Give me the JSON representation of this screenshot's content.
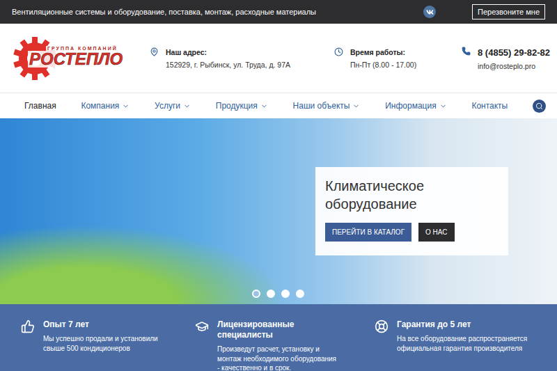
{
  "top_bar": {
    "tagline": "Вентиляционные системы и оборудование, поставка, монтаж, расходные материалы",
    "callback_button": "Перезвоните мне"
  },
  "logo": {
    "caption": "ГРУППА КОМПАНИЙ",
    "name": "РОСТЕПЛО"
  },
  "contacts": [
    {
      "label": "Наш адрес:",
      "value": "152929, г. Рыбинск, ул. Труда, д. 97А"
    },
    {
      "label": "Время работы:",
      "value": "Пн-Пт (8.00 - 17.00)"
    }
  ],
  "phone": {
    "number": "8 (4855) 29-82-82",
    "email": "info@rosteplo.pro"
  },
  "nav": [
    {
      "label": "Главная",
      "selected": true,
      "has_menu": false
    },
    {
      "label": "Компания",
      "selected": false,
      "has_menu": true
    },
    {
      "label": "Услуги",
      "selected": false,
      "has_menu": true
    },
    {
      "label": "Продукция",
      "selected": false,
      "has_menu": true
    },
    {
      "label": "Наши объекты",
      "selected": false,
      "has_menu": true
    },
    {
      "label": "Информация",
      "selected": false,
      "has_menu": true
    },
    {
      "label": "Контакты",
      "selected": false,
      "has_menu": false
    }
  ],
  "hero": {
    "title": "Климатическое оборудование",
    "buttons": [
      {
        "label": "ПЕРЕЙТИ В КАТАЛОГ",
        "kind": "primary"
      },
      {
        "label": "О НАС",
        "kind": "dark"
      }
    ],
    "slides": [
      {
        "selected": true
      },
      {
        "selected": false
      },
      {
        "selected": false
      },
      {
        "selected": false
      }
    ]
  },
  "features": [
    {
      "title": "Опыт 7 лет",
      "text": "Мы успешно продали и установили свыше 500 кондиционеров"
    },
    {
      "title": "Лицензированные специалисты",
      "text": "Произведут расчет, установку и монтаж необходимого оборудования - качественно и в срок."
    },
    {
      "title": "Гарантия до 5 лет",
      "text": "На все оборудование распространяется официальная гарантия производителя"
    }
  ]
}
